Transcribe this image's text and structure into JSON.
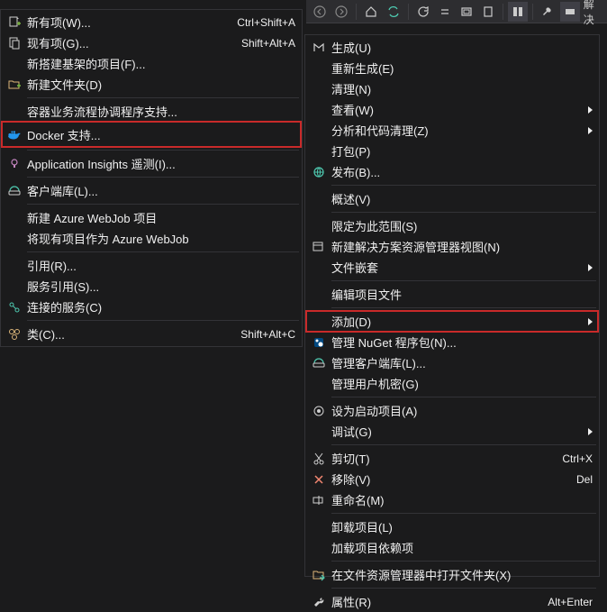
{
  "toolbar_right_label": "解决",
  "left_menu": {
    "items": [
      {
        "icon": "new-item",
        "label": "新有项(W)...",
        "shortcut": "Ctrl+Shift+A"
      },
      {
        "icon": "existing-item",
        "label": "现有项(G)...",
        "shortcut": "Shift+Alt+A"
      },
      {
        "icon": "",
        "label": "新搭建基架的项目(F)..."
      },
      {
        "icon": "new-folder",
        "label": "新建文件夹(D)"
      },
      {
        "sep": true
      },
      {
        "icon": "",
        "label": "容器业务流程协调程序支持..."
      },
      {
        "icon": "docker",
        "label": "Docker 支持...",
        "highlight": true
      },
      {
        "sep": true
      },
      {
        "icon": "app-insights",
        "label": "Application Insights 遥测(I)..."
      },
      {
        "sep": true
      },
      {
        "icon": "client-lib",
        "label": "客户端库(L)..."
      },
      {
        "sep": true
      },
      {
        "icon": "",
        "label": "新建 Azure WebJob 项目"
      },
      {
        "icon": "",
        "label": "将现有项目作为 Azure WebJob"
      },
      {
        "sep": true
      },
      {
        "icon": "",
        "label": "引用(R)..."
      },
      {
        "icon": "",
        "label": "服务引用(S)..."
      },
      {
        "icon": "connected-service",
        "label": "连接的服务(C)"
      },
      {
        "sep": true
      },
      {
        "icon": "class",
        "label": "类(C)...",
        "shortcut": "Shift+Alt+C"
      }
    ]
  },
  "right_menu": {
    "items": [
      {
        "icon": "build",
        "label": "生成(U)"
      },
      {
        "icon": "",
        "label": "重新生成(E)"
      },
      {
        "icon": "",
        "label": "清理(N)"
      },
      {
        "icon": "",
        "label": "查看(W)",
        "submenu": true
      },
      {
        "icon": "",
        "label": "分析和代码清理(Z)",
        "submenu": true
      },
      {
        "icon": "",
        "label": "打包(P)"
      },
      {
        "icon": "publish",
        "label": "发布(B)..."
      },
      {
        "sep": true
      },
      {
        "icon": "",
        "label": "概述(V)"
      },
      {
        "sep": true
      },
      {
        "icon": "",
        "label": "限定为此范围(S)"
      },
      {
        "icon": "explorer-view",
        "label": "新建解决方案资源管理器视图(N)"
      },
      {
        "icon": "",
        "label": "文件嵌套",
        "submenu": true
      },
      {
        "sep": true
      },
      {
        "icon": "",
        "label": "编辑项目文件"
      },
      {
        "sep": true
      },
      {
        "icon": "",
        "label": "添加(D)",
        "submenu": true,
        "highlight": true
      },
      {
        "icon": "nuget",
        "label": "管理 NuGet 程序包(N)..."
      },
      {
        "icon": "client-lib",
        "label": "管理客户端库(L)..."
      },
      {
        "icon": "",
        "label": "管理用户机密(G)"
      },
      {
        "sep": true
      },
      {
        "icon": "startup",
        "label": "设为启动项目(A)"
      },
      {
        "icon": "",
        "label": "调试(G)",
        "submenu": true
      },
      {
        "sep": true
      },
      {
        "icon": "cut",
        "label": "剪切(T)",
        "shortcut": "Ctrl+X"
      },
      {
        "icon": "remove",
        "label": "移除(V)",
        "shortcut": "Del"
      },
      {
        "icon": "rename",
        "label": "重命名(M)"
      },
      {
        "sep": true
      },
      {
        "icon": "",
        "label": "卸载项目(L)"
      },
      {
        "icon": "",
        "label": "加载项目依赖项"
      },
      {
        "sep": true
      },
      {
        "icon": "open-folder",
        "label": "在文件资源管理器中打开文件夹(X)"
      },
      {
        "sep": true
      },
      {
        "icon": "properties",
        "label": "属性(R)",
        "shortcut": "Alt+Enter"
      }
    ]
  }
}
